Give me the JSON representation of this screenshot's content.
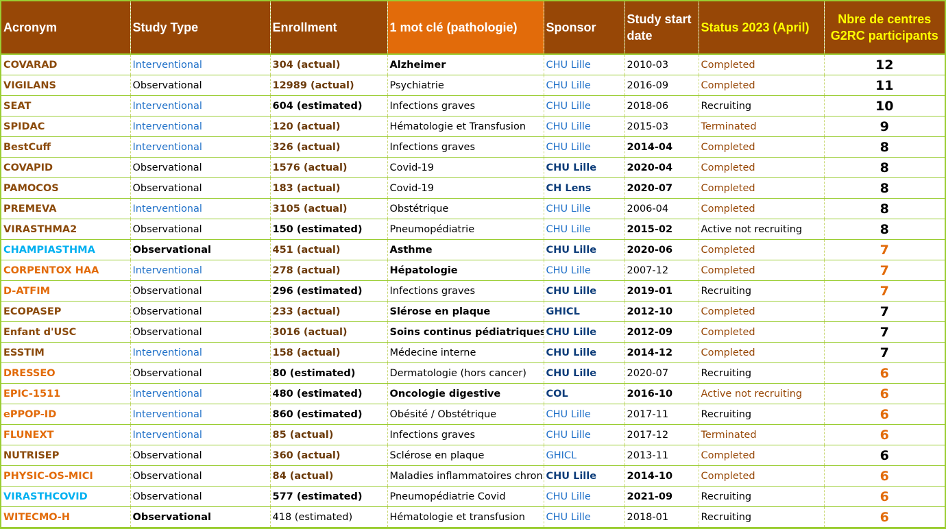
{
  "colors": {
    "header_bg": "#974706",
    "header_highlight_bg": "#e26b0a",
    "header_text": "#ffffff",
    "header_yellow_text": "#ffff00",
    "grid_line": "#9acd32",
    "acronym_brown": "#8b4a0b",
    "acronym_orange": "#e26b0a",
    "acronym_cyan": "#00b0f0",
    "interventional_blue": "#1f70c8",
    "sponsor_blue": "#1f70c8",
    "sponsor_dark_blue": "#0d3d7a",
    "status_brown": "#974706",
    "enrollment_brown": "#6b3a0a",
    "count_orange": "#e26b0a",
    "black": "#000000"
  },
  "headers": [
    {
      "label": "Acronym"
    },
    {
      "label": "Study Type"
    },
    {
      "label": "Enrollment"
    },
    {
      "label": "1 mot clé (pathologie)"
    },
    {
      "label": "Sponsor"
    },
    {
      "label": "Study start date"
    },
    {
      "label": "Status 2023 (April)"
    },
    {
      "label": "Nbre de centres G2RC participants"
    }
  ],
  "rows": [
    {
      "acronym": "COVARAD",
      "acronym_color": "brown",
      "study_type": "Interventional",
      "enrollment": "304 (actual)",
      "keyword": "Alzheimer",
      "keyword_bold": true,
      "sponsor": "CHU Lille",
      "sponsor_bold": false,
      "start_date": "2010-03",
      "date_bold": false,
      "status": "Completed",
      "status_color": "brown",
      "centres": "12",
      "centres_color": "black"
    },
    {
      "acronym": "VIGILANS",
      "acronym_color": "brown",
      "study_type": "Observational",
      "enrollment": "12989 (actual)",
      "keyword": "Psychiatrie",
      "keyword_bold": false,
      "sponsor": "CHU Lille",
      "sponsor_bold": false,
      "start_date": "2016-09",
      "date_bold": false,
      "status": "Completed",
      "status_color": "brown",
      "centres": "11",
      "centres_color": "black"
    },
    {
      "acronym": "SEAT",
      "acronym_color": "brown",
      "study_type": "Interventional",
      "enrollment": "604 (estimated)",
      "keyword": "Infections graves",
      "keyword_bold": false,
      "sponsor": "CHU Lille",
      "sponsor_bold": false,
      "start_date": "2018-06",
      "date_bold": false,
      "status": "Recruiting",
      "status_color": "black",
      "centres": "10",
      "centres_color": "black"
    },
    {
      "acronym": "SPIDAC",
      "acronym_color": "brown",
      "study_type": "Interventional",
      "enrollment": "120 (actual)",
      "keyword": "Hématologie et Transfusion",
      "keyword_bold": false,
      "sponsor": "CHU Lille",
      "sponsor_bold": false,
      "start_date": "2015-03",
      "date_bold": false,
      "status": "Terminated",
      "status_color": "brown",
      "centres": "9",
      "centres_color": "black"
    },
    {
      "acronym": "BestCuff",
      "acronym_color": "brown",
      "study_type": "Interventional",
      "enrollment": "326 (actual)",
      "keyword": "Infections graves",
      "keyword_bold": false,
      "sponsor": "CHU Lille",
      "sponsor_bold": false,
      "start_date": "2014-04",
      "date_bold": true,
      "status": "Completed",
      "status_color": "brown",
      "centres": "8",
      "centres_color": "black"
    },
    {
      "acronym": "COVAPID",
      "acronym_color": "brown",
      "study_type": "Observational",
      "enrollment": "1576 (actual)",
      "keyword": "Covid-19",
      "keyword_bold": false,
      "sponsor": "CHU Lille",
      "sponsor_bold": true,
      "start_date": "2020-04",
      "date_bold": true,
      "status": "Completed",
      "status_color": "brown",
      "centres": "8",
      "centres_color": "black"
    },
    {
      "acronym": "PAMOCOS",
      "acronym_color": "brown",
      "study_type": "Observational",
      "enrollment": "183 (actual)",
      "keyword": "Covid-19",
      "keyword_bold": false,
      "sponsor": "CH Lens",
      "sponsor_bold": true,
      "start_date": "2020-07",
      "date_bold": true,
      "status": "Completed",
      "status_color": "brown",
      "centres": "8",
      "centres_color": "black"
    },
    {
      "acronym": "PREMEVA",
      "acronym_color": "brown",
      "study_type": "Interventional",
      "enrollment": "3105 (actual)",
      "keyword": "Obstétrique",
      "keyword_bold": false,
      "sponsor": "CHU Lille",
      "sponsor_bold": false,
      "start_date": "2006-04",
      "date_bold": false,
      "status": "Completed",
      "status_color": "brown",
      "centres": "8",
      "centres_color": "black"
    },
    {
      "acronym": "VIRASTHMA2",
      "acronym_color": "brown",
      "study_type": "Observational",
      "enrollment": "150 (estimated)",
      "keyword": "Pneumopédiatrie",
      "keyword_bold": false,
      "sponsor": "CHU Lille",
      "sponsor_bold": false,
      "start_date": "2015-02",
      "date_bold": true,
      "status": "Active not recruiting",
      "status_color": "black",
      "centres": "8",
      "centres_color": "black"
    },
    {
      "acronym": "CHAMPIASTHMA",
      "acronym_color": "cyan",
      "study_type": "Observational",
      "study_type_bold": true,
      "enrollment": "451 (actual)",
      "keyword": "Asthme",
      "keyword_bold": true,
      "sponsor": "CHU Lille",
      "sponsor_bold": true,
      "start_date": "2020-06",
      "date_bold": true,
      "status": "Completed",
      "status_color": "brown",
      "centres": "7",
      "centres_color": "orange"
    },
    {
      "acronym": "CORPENTOX HAA",
      "acronym_color": "orange",
      "study_type": "Interventional",
      "enrollment": "278 (actual)",
      "keyword": "Hépatologie",
      "keyword_bold": true,
      "sponsor": "CHU Lille",
      "sponsor_bold": false,
      "start_date": "2007-12",
      "date_bold": false,
      "status": "Completed",
      "status_color": "brown",
      "centres": "7",
      "centres_color": "orange"
    },
    {
      "acronym": "D-ATFIM",
      "acronym_color": "orange",
      "study_type": "Observational",
      "enrollment": "296 (estimated)",
      "keyword": "Infections graves",
      "keyword_bold": false,
      "sponsor": "CHU Lille",
      "sponsor_bold": true,
      "start_date": "2019-01",
      "date_bold": true,
      "status": "Recruiting",
      "status_color": "black",
      "centres": "7",
      "centres_color": "orange"
    },
    {
      "acronym": "ECOPASEP",
      "acronym_color": "brown",
      "study_type": "Observational",
      "enrollment": "233 (actual)",
      "keyword": "Slérose en plaque",
      "keyword_bold": true,
      "sponsor": "GHICL",
      "sponsor_bold": true,
      "start_date": "2012-10",
      "date_bold": true,
      "status": "Completed",
      "status_color": "brown",
      "centres": "7",
      "centres_color": "black"
    },
    {
      "acronym": "Enfant d'USC",
      "acronym_color": "brown",
      "study_type": "Observational",
      "enrollment": "3016 (actual)",
      "keyword": "Soins continus pédiatriques",
      "keyword_bold": true,
      "sponsor": "CHU Lille",
      "sponsor_bold": true,
      "start_date": "2012-09",
      "date_bold": true,
      "status": "Completed",
      "status_color": "brown",
      "centres": "7",
      "centres_color": "black"
    },
    {
      "acronym": "ESSTIM",
      "acronym_color": "brown",
      "study_type": "Interventional",
      "enrollment": "158 (actual)",
      "keyword": "Médecine interne",
      "keyword_bold": false,
      "sponsor": "CHU Lille",
      "sponsor_bold": true,
      "start_date": "2014-12",
      "date_bold": true,
      "status": "Completed",
      "status_color": "brown",
      "centres": "7",
      "centres_color": "black"
    },
    {
      "acronym": "DRESSEO",
      "acronym_color": "orange",
      "study_type": "Observational",
      "enrollment": "80 (estimated)",
      "keyword": "Dermatologie (hors cancer)",
      "keyword_bold": false,
      "sponsor": "CHU Lille",
      "sponsor_bold": true,
      "start_date": "2020-07",
      "date_bold": false,
      "status": "Recruiting",
      "status_color": "black",
      "centres": "6",
      "centres_color": "orange"
    },
    {
      "acronym": "EPIC-1511",
      "acronym_color": "orange",
      "study_type": "Interventional",
      "enrollment": "480 (estimated)",
      "keyword": "Oncologie digestive",
      "keyword_bold": true,
      "sponsor": "COL",
      "sponsor_bold": true,
      "start_date": "2016-10",
      "date_bold": true,
      "status": "Active not recruiting",
      "status_color": "brown",
      "centres": "6",
      "centres_color": "orange"
    },
    {
      "acronym": "ePPOP-ID",
      "acronym_color": "orange",
      "study_type": "Interventional",
      "enrollment": "860 (estimated)",
      "keyword": "Obésité / Obstétrique",
      "keyword_bold": false,
      "sponsor": "CHU Lille",
      "sponsor_bold": false,
      "start_date": "2017-11",
      "date_bold": false,
      "status": "Recruiting",
      "status_color": "black",
      "centres": "6",
      "centres_color": "orange"
    },
    {
      "acronym": "FLUNEXT",
      "acronym_color": "orange",
      "study_type": "Interventional",
      "enrollment": "85 (actual)",
      "keyword": "Infections graves",
      "keyword_bold": false,
      "sponsor": "CHU Lille",
      "sponsor_bold": false,
      "start_date": "2017-12",
      "date_bold": false,
      "status": "Terminated",
      "status_color": "brown",
      "centres": "6",
      "centres_color": "orange"
    },
    {
      "acronym": "NUTRISEP",
      "acronym_color": "brown",
      "study_type": "Observational",
      "enrollment": "360 (actual)",
      "keyword": "Sclérose en plaque",
      "keyword_bold": false,
      "sponsor": "GHICL",
      "sponsor_bold": false,
      "start_date": "2013-11",
      "date_bold": false,
      "status": "Completed",
      "status_color": "brown",
      "centres": "6",
      "centres_color": "black"
    },
    {
      "acronym": "PHYSIC-OS-MICI",
      "acronym_color": "orange",
      "study_type": "Observational",
      "enrollment": "84 (actual)",
      "keyword": "Maladies inflammatoires chroniques",
      "keyword_bold": false,
      "sponsor": "CHU Lille",
      "sponsor_bold": true,
      "start_date": "2014-10",
      "date_bold": true,
      "status": "Completed",
      "status_color": "brown",
      "centres": "6",
      "centres_color": "orange"
    },
    {
      "acronym": "VIRASTHCOVID",
      "acronym_color": "cyan",
      "study_type": "Observational",
      "enrollment": "577 (estimated)",
      "keyword": "Pneumopédiatrie Covid",
      "keyword_bold": false,
      "sponsor": "CHU Lille",
      "sponsor_bold": false,
      "start_date": "2021-09",
      "date_bold": true,
      "status": "Recruiting",
      "status_color": "black",
      "centres": "6",
      "centres_color": "orange"
    },
    {
      "acronym": "WITECMO-H",
      "acronym_color": "orange",
      "study_type": "Observational",
      "study_type_bold": true,
      "enrollment": "418 (estimated)",
      "enrollment_plain": true,
      "keyword": "Hématologie et transfusion",
      "keyword_bold": false,
      "sponsor": "CHU Lille",
      "sponsor_bold": false,
      "start_date": "2018-01",
      "date_bold": false,
      "status": "Recruiting",
      "status_color": "black",
      "centres": "6",
      "centres_color": "orange"
    }
  ]
}
